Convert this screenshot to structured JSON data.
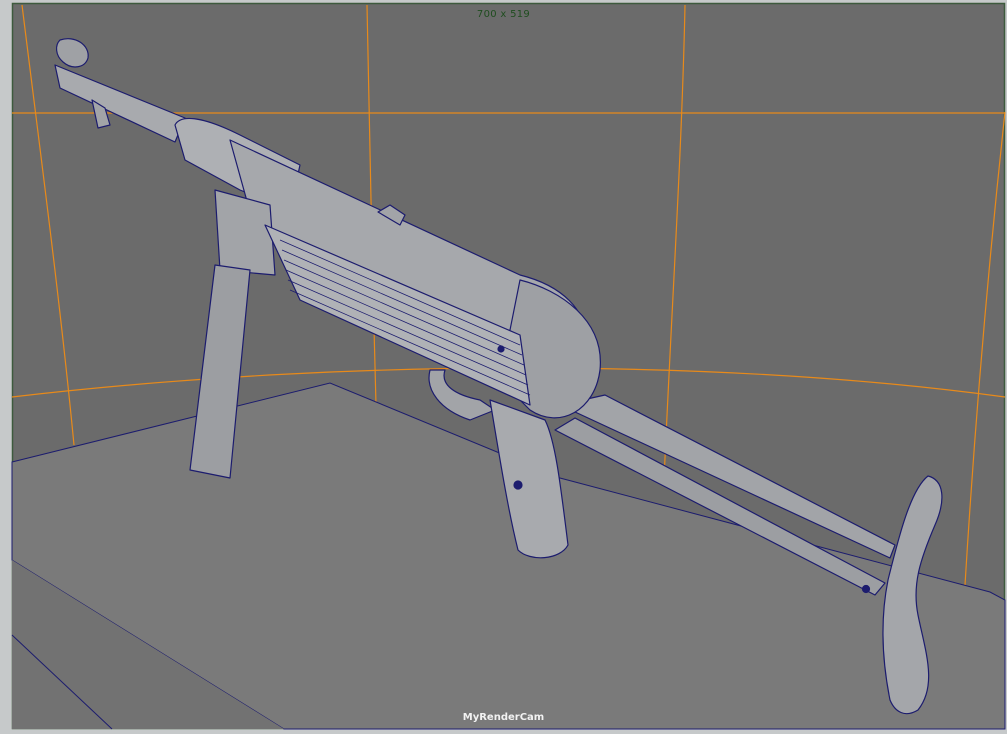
{
  "viewport": {
    "resolution_gate_label": "700 x 519",
    "camera_name": "MyRenderCam"
  },
  "colors": {
    "background": "#6b6b6b",
    "floor": "#7a7a7a",
    "gate_lines": "#e88a1a",
    "wireframe": "#1c1c6e",
    "model_fill": "#a2a4a8"
  },
  "model": {
    "name": "submachine-gun",
    "display_mode": "wireframe-on-shaded"
  }
}
